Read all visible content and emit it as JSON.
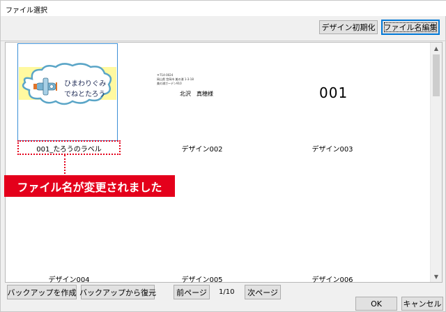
{
  "window": {
    "title": "ファイル選択"
  },
  "toolbar": {
    "reset_design": "デザイン初期化",
    "edit_filename": "ファイル名編集"
  },
  "designs": [
    {
      "caption": "001_たろうのラベル",
      "label_line1": "ひまわりぐみ",
      "label_line2": "でねとたろう"
    },
    {
      "caption": "デザイン002",
      "postal": "〒714-0024",
      "addr_line1": "岡山県 笠岡市 美の浦 1-3-18",
      "addr_line2": "美の浦ガーデン910",
      "recipient": "北沢　真穂様"
    },
    {
      "caption": "デザイン003",
      "number_text": "001"
    },
    {
      "caption": "デザイン004"
    },
    {
      "caption": "デザイン005"
    },
    {
      "caption": "デザイン006"
    }
  ],
  "annotation": {
    "text": "ファイル名が変更されました"
  },
  "footer": {
    "create_backup": "バックアップを作成",
    "restore_backup": "バックアップから復元",
    "prev_page": "前ページ",
    "page_indicator": "1/10",
    "next_page": "次ページ",
    "ok": "OK",
    "cancel": "キャンセル"
  },
  "colors": {
    "accent_red": "#e4001b",
    "selection_blue": "#3c8fd6",
    "label_yellow": "#fff9a0",
    "cloud_border": "#5aa5c7"
  }
}
